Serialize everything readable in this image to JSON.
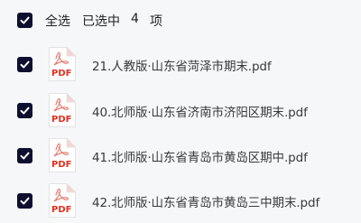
{
  "header": {
    "select_all_label": "全选",
    "selected_prefix": "已选中",
    "selected_count": "4",
    "selected_unit": "项",
    "select_all_checked": true
  },
  "files": [
    {
      "name": "21.人教版·山东省菏泽市期末.pdf",
      "checked": true,
      "icon": "pdf-icon",
      "icon_text": "PDF"
    },
    {
      "name": "40.北师版·山东省济南市济阳区期末.pdf",
      "checked": true,
      "icon": "pdf-icon",
      "icon_text": "PDF"
    },
    {
      "name": "41.北师版·山东省青岛市黄岛区期中.pdf",
      "checked": true,
      "icon": "pdf-icon",
      "icon_text": "PDF"
    },
    {
      "name": "42.北师版·山东省青岛市黄岛三中期末.pdf",
      "checked": true,
      "icon": "pdf-icon",
      "icon_text": "PDF"
    }
  ],
  "colors": {
    "background": "#f6f7f9",
    "checkbox_fill": "#0c0f2e",
    "pdf_red": "#e0301e",
    "pdf_page": "#ffffff",
    "text": "#3a3a3a"
  }
}
